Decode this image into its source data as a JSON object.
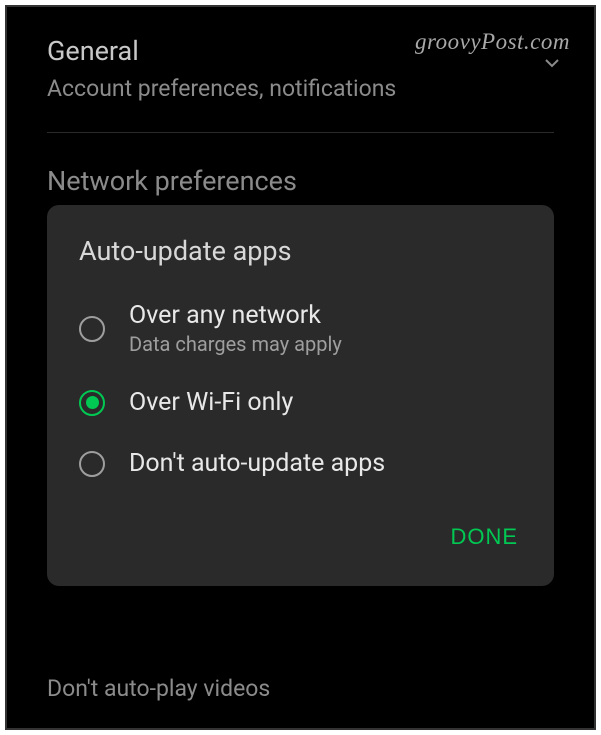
{
  "watermark": "groovyPost.com",
  "background": {
    "general": {
      "title": "General",
      "subtitle": "Account preferences, notifications"
    },
    "network": {
      "title": "Network preferences"
    },
    "autoplay": "Don't auto-play videos"
  },
  "dialog": {
    "title": "Auto-update apps",
    "options": [
      {
        "label": "Over any network",
        "sublabel": "Data charges may apply",
        "selected": false
      },
      {
        "label": "Over Wi-Fi only",
        "selected": true
      },
      {
        "label": "Don't auto-update apps",
        "selected": false
      }
    ],
    "done": "DONE"
  }
}
